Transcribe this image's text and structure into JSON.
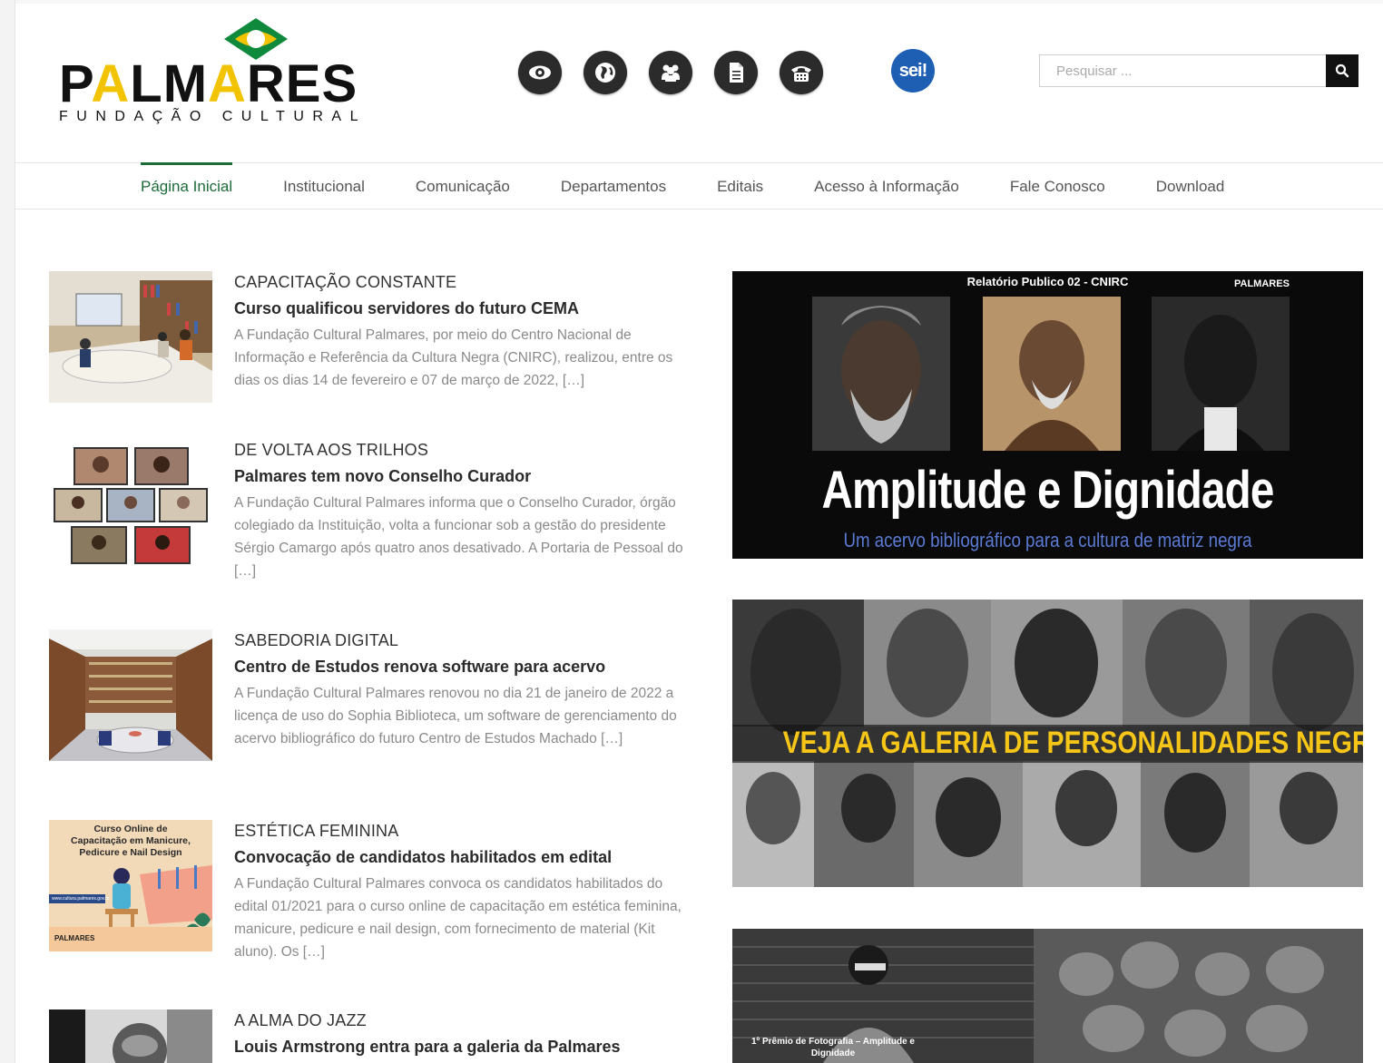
{
  "header": {
    "logo": {
      "word_left": "P",
      "word_a1": "A",
      "word_mid": "LM",
      "word_a2": "A",
      "word_right": "RES",
      "subtitle": "FUNDAÇÃO CULTURAL"
    },
    "icons": [
      "eye-icon",
      "globe-icon",
      "people-icon",
      "document-icon",
      "telephone-icon"
    ],
    "sei_label": "sei!",
    "search": {
      "placeholder": "Pesquisar ..."
    }
  },
  "nav": {
    "items": [
      {
        "label": "Página Inicial",
        "active": true
      },
      {
        "label": "Institucional"
      },
      {
        "label": "Comunicação"
      },
      {
        "label": "Departamentos"
      },
      {
        "label": "Editais"
      },
      {
        "label": "Acesso à Informação"
      },
      {
        "label": "Fale Conosco"
      },
      {
        "label": "Download"
      }
    ]
  },
  "news": [
    {
      "kicker": "CAPACITAÇÃO CONSTANTE",
      "headline": "Curso qualificou servidores do futuro CEMA",
      "excerpt": "A Fundação Cultural Palmares, por meio do Centro Nacional de Informação e Referência da Cultura Negra (CNIRC), realizou, entre os dias os dias 14 de fevereiro e 07 de março de 2022, […]"
    },
    {
      "kicker": "DE VOLTA AOS TRILHOS",
      "headline": "Palmares tem novo Conselho Curador",
      "excerpt": "A Fundação Cultural Palmares informa que o Conselho Curador, órgão colegiado da Instituição, volta a funcionar sob a gestão do presidente Sérgio Camargo após quatro anos desativado. A Portaria de Pessoal do […]"
    },
    {
      "kicker": "SABEDORIA DIGITAL",
      "headline": "Centro de Estudos renova software para acervo",
      "excerpt": "A Fundação Cultural Palmares renovou no dia 21 de janeiro de 2022 a licença de uso do Sophia Biblioteca, um software de gerenciamento do acervo bibliográfico do futuro Centro de Estudos Machado […]"
    },
    {
      "kicker": "ESTÉTICA FEMININA",
      "headline": "Convocação de candidatos habilitados em edital",
      "excerpt": "A Fundação Cultural Palmares convoca os candidatos habilitados do edital 01/2021 para o curso online de capacitação em estética feminina, manicure, pedicure e nail design, com fornecimento de material (Kit aluno). Os […]",
      "thumb_text": "Curso Online de Capacitação em Manicure, Pedicure e Nail Design",
      "thumb_url": "www.cultura.palmares.gov.br"
    },
    {
      "kicker": "A ALMA DO JAZZ",
      "headline": "Louis Armstrong entra para a galeria da Palmares",
      "excerpt": ""
    }
  ],
  "banners": {
    "b1": {
      "top": "Relatório Publico 02 - CNIRC",
      "logo": "PALMARES",
      "title": "Amplitude e Dignidade",
      "subtitle": "Um acervo bibliográfico para a cultura de matriz negra"
    },
    "b2": {
      "title": "VEJA A GALERIA DE PERSONALIDADES NEGRAS"
    },
    "b3": {
      "caption": "1º Prêmio de Fotografia – Amplitude e Dignidade"
    }
  },
  "colors": {
    "accent_green": "#1e6b3a",
    "logo_yellow": "#f2c300",
    "sei_blue": "#1e5fb4",
    "banner_yellow": "#f5c518"
  }
}
